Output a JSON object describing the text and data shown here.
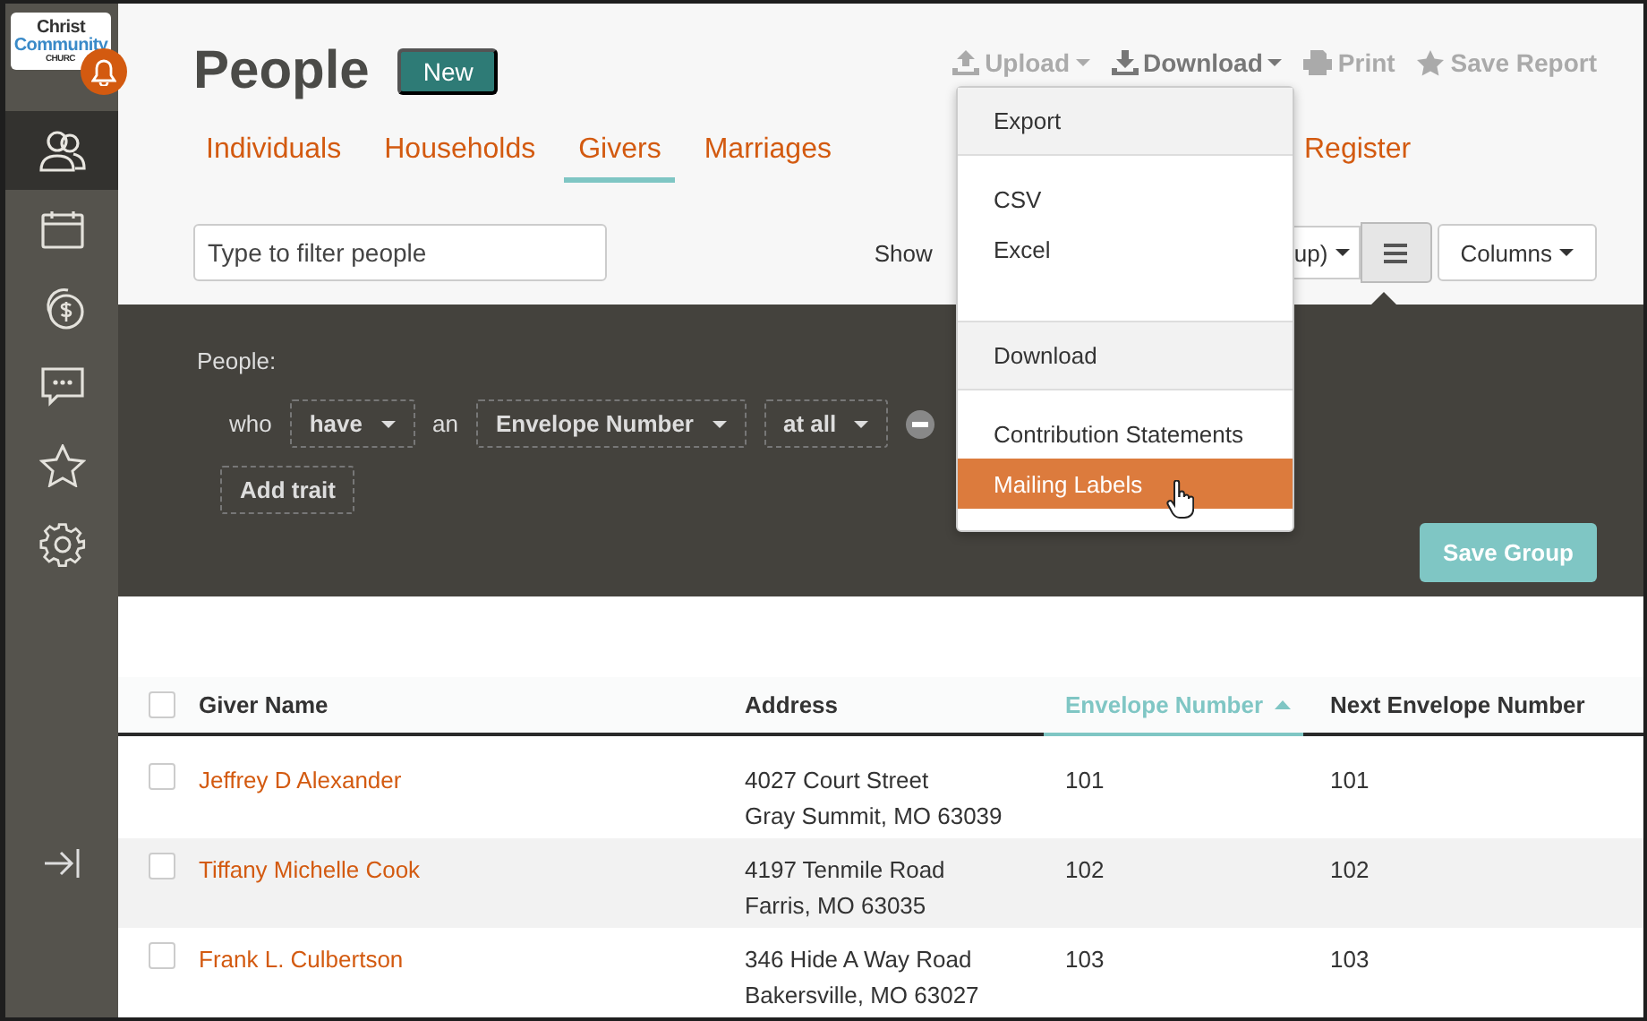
{
  "logo": {
    "lines": [
      "Christ",
      "Community",
      "CHURC"
    ]
  },
  "sidebar": {
    "items": [
      {
        "kind": "people",
        "selected": true
      },
      {
        "kind": "calendar",
        "selected": false
      },
      {
        "kind": "giving",
        "selected": false
      },
      {
        "kind": "chat",
        "selected": false
      },
      {
        "kind": "star",
        "selected": false
      },
      {
        "kind": "gear",
        "selected": false
      }
    ]
  },
  "header": {
    "title": "People",
    "badge": "New"
  },
  "actions": [
    {
      "kind": "upload",
      "label": "Upload",
      "caret": true,
      "open": false
    },
    {
      "kind": "download",
      "label": "Download",
      "caret": true,
      "open": true
    },
    {
      "kind": "print",
      "label": "Print",
      "caret": false,
      "open": false
    },
    {
      "kind": "star",
      "label": "Save Report",
      "caret": false,
      "open": false
    }
  ],
  "tabs": [
    {
      "label": "Individuals",
      "selected": false
    },
    {
      "label": "Households",
      "selected": false
    },
    {
      "label": "Givers",
      "selected": true
    },
    {
      "label": "Marriages",
      "selected": false
    },
    {
      "label": "Register",
      "selected": false
    }
  ],
  "filter": {
    "placeholder": "Type to filter people"
  },
  "view": {
    "show_label": "Show",
    "dropdown_value": "up)",
    "columns_label": "Columns"
  },
  "menu": {
    "items": [
      {
        "kind": "header",
        "label": "Export"
      },
      {
        "kind": "item",
        "label": "CSV",
        "selected": false
      },
      {
        "kind": "item",
        "label": "Excel",
        "selected": false
      },
      {
        "kind": "header",
        "label": "Download"
      },
      {
        "kind": "item",
        "label": "Contribution Statements",
        "selected": false
      },
      {
        "kind": "item",
        "label": "Mailing Labels",
        "selected": true
      }
    ]
  },
  "group": {
    "title": "People:",
    "parts": [
      {
        "kind": "text",
        "label": "who"
      },
      {
        "kind": "select",
        "label": "have"
      },
      {
        "kind": "text",
        "label": "an"
      },
      {
        "kind": "select",
        "label": "Envelope Number"
      },
      {
        "kind": "select",
        "label": "at all"
      },
      {
        "kind": "remove"
      }
    ],
    "add_label": "Add trait",
    "save_label": "Save Group"
  },
  "table": {
    "all_checked": false,
    "columns": [
      {
        "label": "Giver Name",
        "sorted": false
      },
      {
        "label": "Address",
        "sorted": false
      },
      {
        "label": "Envelope Number",
        "sorted": true
      },
      {
        "label": "Next Envelope Number",
        "sorted": false
      }
    ],
    "rows": [
      {
        "checked": false,
        "name": "Jeffrey D Alexander",
        "address": [
          "4027 Court Street",
          "Gray Summit, MO  63039"
        ],
        "envelope": "101",
        "next": "101"
      },
      {
        "checked": false,
        "name": "Tiffany Michelle Cook",
        "address": [
          "4197 Tenmile Road",
          "Farris, MO  63035"
        ],
        "envelope": "102",
        "next": "102"
      },
      {
        "checked": false,
        "name": "Frank L. Culbertson",
        "address": [
          "346 Hide A Way Road",
          "Bakersville, MO  63027"
        ],
        "envelope": "103",
        "next": "103"
      }
    ]
  }
}
